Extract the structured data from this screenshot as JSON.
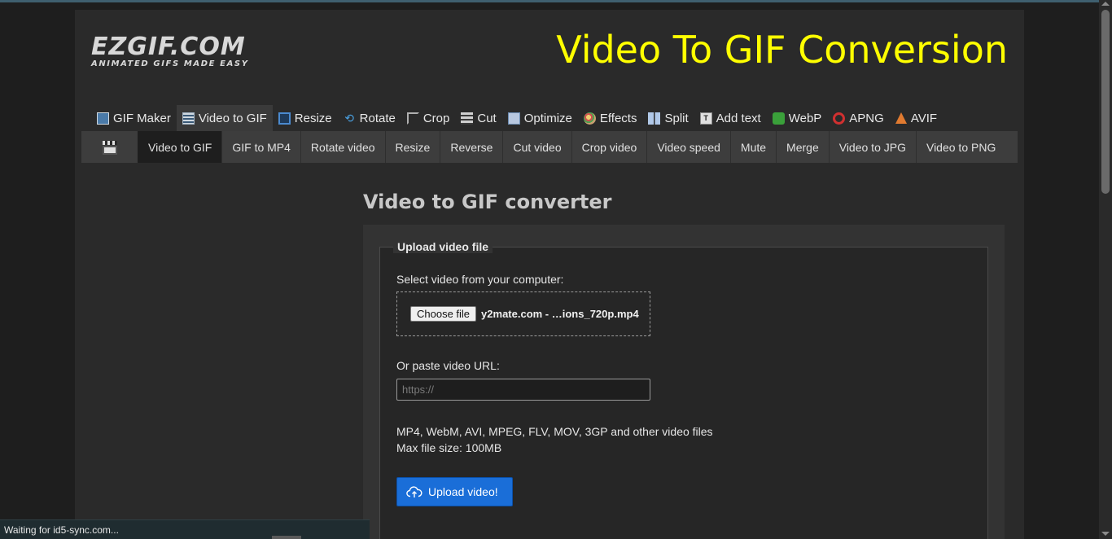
{
  "site": {
    "logo_text": "EZGIF.COM",
    "logo_tagline": "ANIMATED GIFS MADE EASY",
    "headline": "Video To GIF Conversion"
  },
  "main_nav": [
    {
      "label": "GIF Maker",
      "icon": "gif-maker-icon",
      "active": false
    },
    {
      "label": "Video to GIF",
      "icon": "film-icon",
      "active": true
    },
    {
      "label": "Resize",
      "icon": "resize-icon",
      "active": false
    },
    {
      "label": "Rotate",
      "icon": "rotate-icon",
      "active": false
    },
    {
      "label": "Crop",
      "icon": "crop-icon",
      "active": false
    },
    {
      "label": "Cut",
      "icon": "cut-icon",
      "active": false
    },
    {
      "label": "Optimize",
      "icon": "optimize-icon",
      "active": false
    },
    {
      "label": "Effects",
      "icon": "effects-palette-icon",
      "active": false
    },
    {
      "label": "Split",
      "icon": "split-icon",
      "active": false
    },
    {
      "label": "Add text",
      "icon": "add-text-icon",
      "active": false
    },
    {
      "label": "WebP",
      "icon": "webp-icon",
      "active": false
    },
    {
      "label": "APNG",
      "icon": "apng-icon",
      "active": false
    },
    {
      "label": "AVIF",
      "icon": "avif-icon",
      "active": false
    }
  ],
  "sub_nav": [
    {
      "label": "Video to GIF",
      "active": true
    },
    {
      "label": "GIF to MP4",
      "active": false
    },
    {
      "label": "Rotate video",
      "active": false
    },
    {
      "label": "Resize",
      "active": false
    },
    {
      "label": "Reverse",
      "active": false
    },
    {
      "label": "Cut video",
      "active": false
    },
    {
      "label": "Crop video",
      "active": false
    },
    {
      "label": "Video speed",
      "active": false
    },
    {
      "label": "Mute",
      "active": false
    },
    {
      "label": "Merge",
      "active": false
    },
    {
      "label": "Video to JPG",
      "active": false
    },
    {
      "label": "Video to PNG",
      "active": false
    }
  ],
  "converter": {
    "title": "Video to GIF converter",
    "legend": "Upload video file",
    "select_label": "Select video from your computer:",
    "choose_file_label": "Choose file",
    "selected_file": "y2mate.com - …ions_720p.mp4",
    "url_label": "Or paste video URL:",
    "url_placeholder": "https://",
    "url_value": "",
    "formats_note": "MP4, WebM, AVI, MPEG, FLV, MOV, 3GP and other video files",
    "max_size_note": "Max file size: 100MB",
    "upload_button": "Upload video!"
  },
  "browser_status": "Waiting for id5-sync.com...",
  "colors": {
    "headline": "#ffff00",
    "upload_button": "#1a6ed8",
    "page_bg": "#1e1e1e"
  }
}
